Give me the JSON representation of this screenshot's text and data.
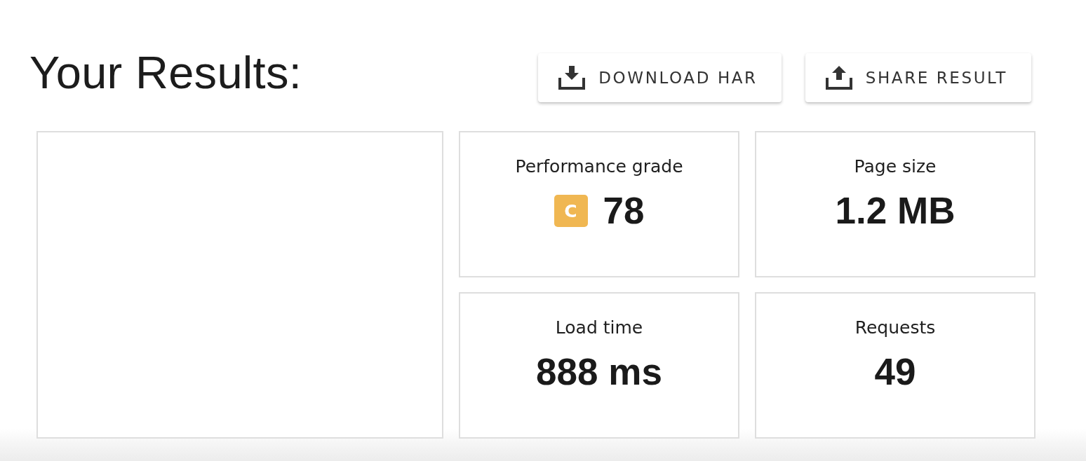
{
  "title": "Your Results:",
  "actions": [
    {
      "kind": "download",
      "label": "DOWNLOAD HAR"
    },
    {
      "kind": "upload",
      "label": "SHARE RESULT"
    }
  ],
  "metrics": [
    {
      "kind": "grade",
      "label": "Performance grade",
      "grade": "C",
      "color": "#f0b752",
      "value": "78"
    },
    {
      "kind": "plain",
      "label": "Page size",
      "value": "1.2 MB"
    },
    {
      "kind": "plain",
      "label": "Load time",
      "value": "888 ms"
    },
    {
      "kind": "plain",
      "label": "Requests",
      "value": "49"
    }
  ]
}
